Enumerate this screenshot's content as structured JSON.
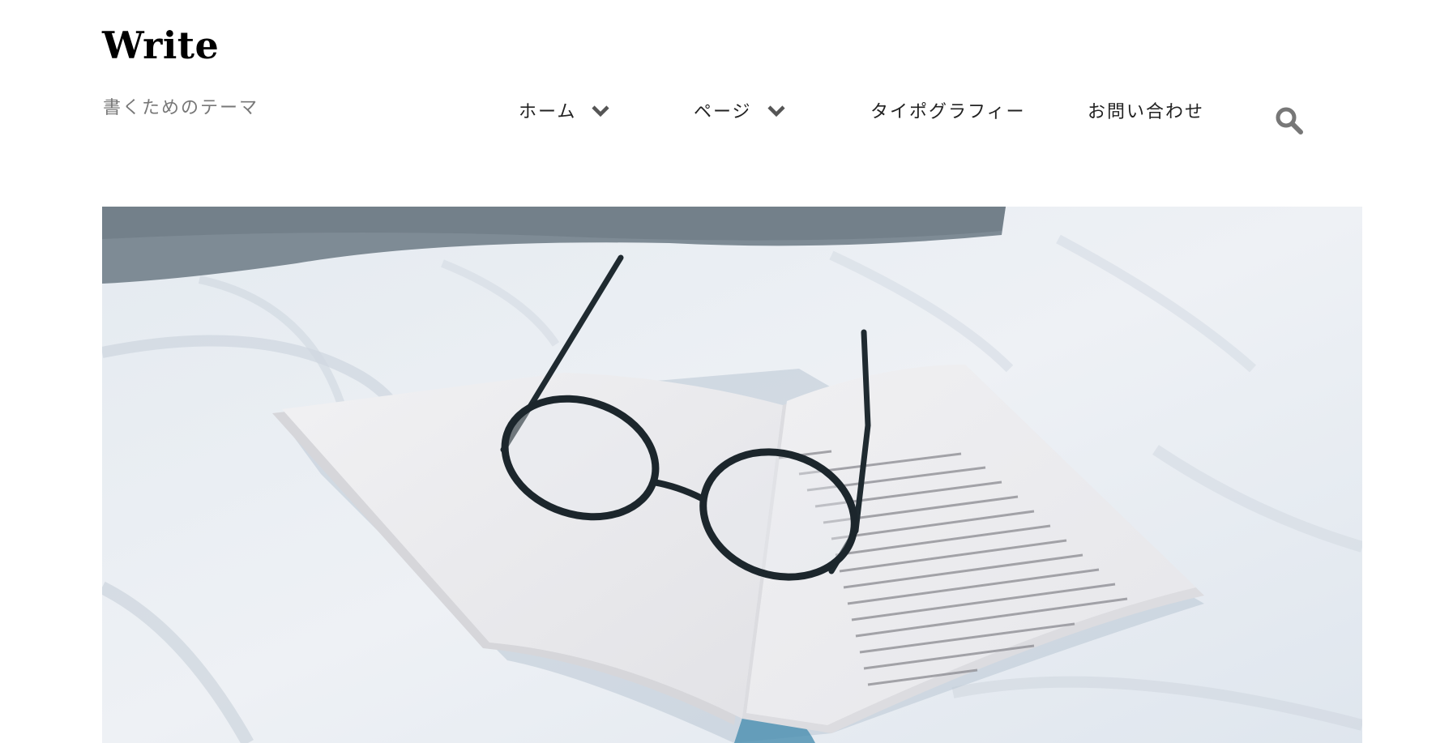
{
  "header": {
    "site_title": "Write",
    "site_description": "書くためのテーマ"
  },
  "nav": {
    "items": [
      {
        "label": "ホーム",
        "has_dropdown": true,
        "icon": "chevron-down-icon"
      },
      {
        "label": "ページ",
        "has_dropdown": true,
        "icon": "chevron-down-icon"
      },
      {
        "label": "タイポグラフィー",
        "has_dropdown": false
      },
      {
        "label": "お問い合わせ",
        "has_dropdown": false
      }
    ],
    "search_icon": "search-icon"
  },
  "hero": {
    "image_subject": "open book with eyeglasses on white bedsheet",
    "icon": "featured-image"
  },
  "colors": {
    "background": "#ffffff",
    "title": "#000000",
    "description": "#777777",
    "nav_text": "#222222",
    "chevron": "#555555",
    "search_icon": "#777777"
  }
}
